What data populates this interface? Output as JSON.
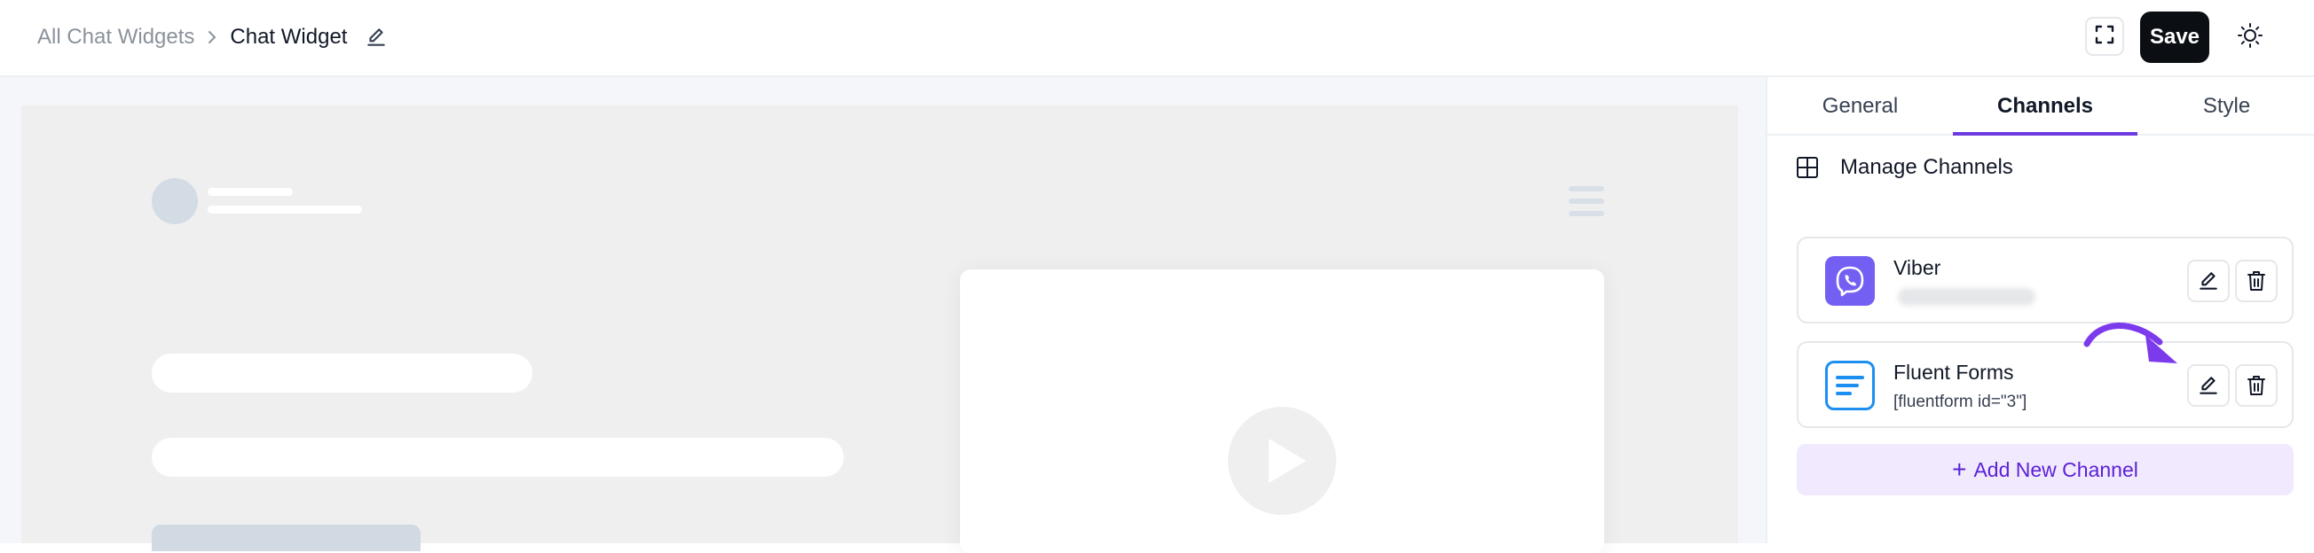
{
  "header": {
    "breadcrumb_parent": "All Chat Widgets",
    "breadcrumb_current": "Chat Widget",
    "save_label": "Save"
  },
  "sidebar": {
    "tabs": [
      {
        "label": "General",
        "active": false
      },
      {
        "label": "Channels",
        "active": true
      },
      {
        "label": "Style",
        "active": false
      }
    ],
    "section_title": "Manage Channels",
    "channels": [
      {
        "name": "Viber",
        "subtitle": "",
        "icon": "viber-icon"
      },
      {
        "name": "Fluent Forms",
        "subtitle": "[fluentform id=\"3\"]",
        "icon": "fluent-forms-icon"
      }
    ],
    "add_button_label": "Add New Channel",
    "add_button_prefix": "+"
  },
  "colors": {
    "accent": "#6d3ae0",
    "viber": "#7360f2",
    "fluent_forms": "#1d8ff0",
    "save_bg": "#0b0f14"
  }
}
